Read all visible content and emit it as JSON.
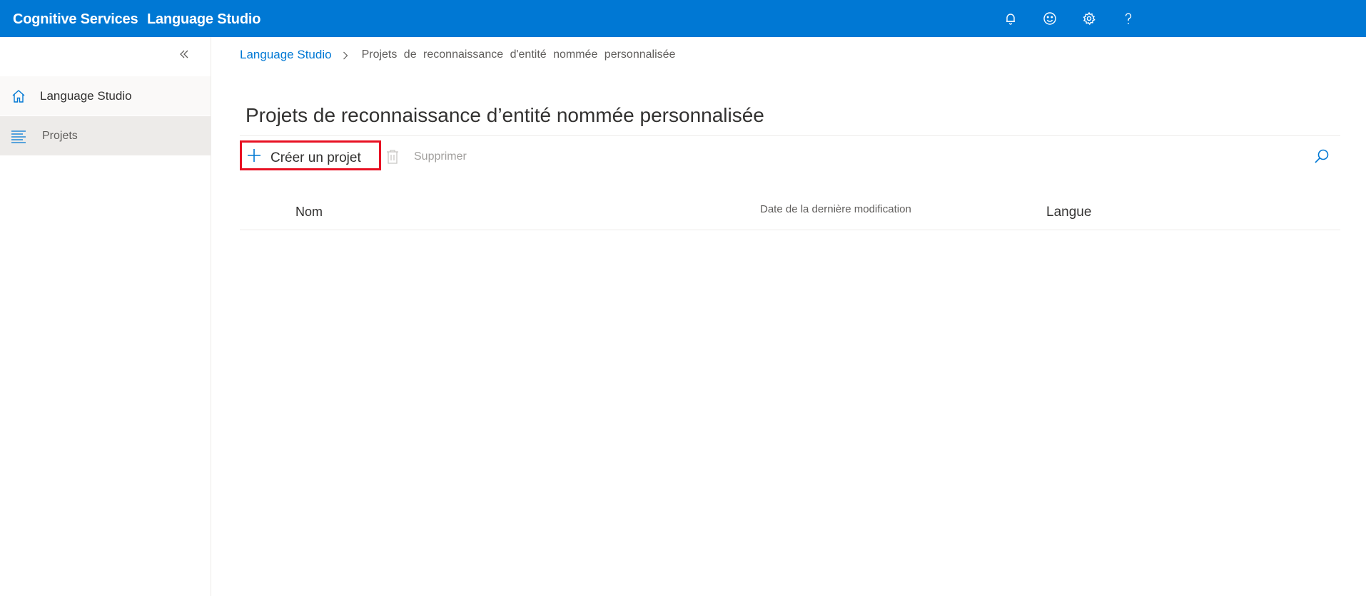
{
  "header": {
    "brand": "Cognitive Services",
    "product": "Language Studio",
    "icons": [
      "bell-icon",
      "smiley-icon",
      "gear-icon",
      "help-icon"
    ]
  },
  "sidebar": {
    "collapse_icon": "double-chevron-left-icon",
    "items": [
      {
        "label": "Language Studio",
        "icon": "home-icon"
      },
      {
        "label": "Projets",
        "icon": "list-icon",
        "selected": true
      }
    ]
  },
  "breadcrumb": {
    "root": "Language Studio",
    "current": "Projets de reconnaissance d'entité nommée personnalisée"
  },
  "page": {
    "title": "Projets de reconnaissance d’entité nommée personnalisée"
  },
  "toolbar": {
    "create_label": "Créer un projet",
    "delete_label": "Supprimer"
  },
  "table": {
    "columns": [
      "Nom",
      "Date de la dernière modification",
      "Langue"
    ],
    "rows": []
  },
  "colors": {
    "header_bg": "#0078d4",
    "accent": "#0078d4",
    "highlight_border": "#e81123"
  }
}
